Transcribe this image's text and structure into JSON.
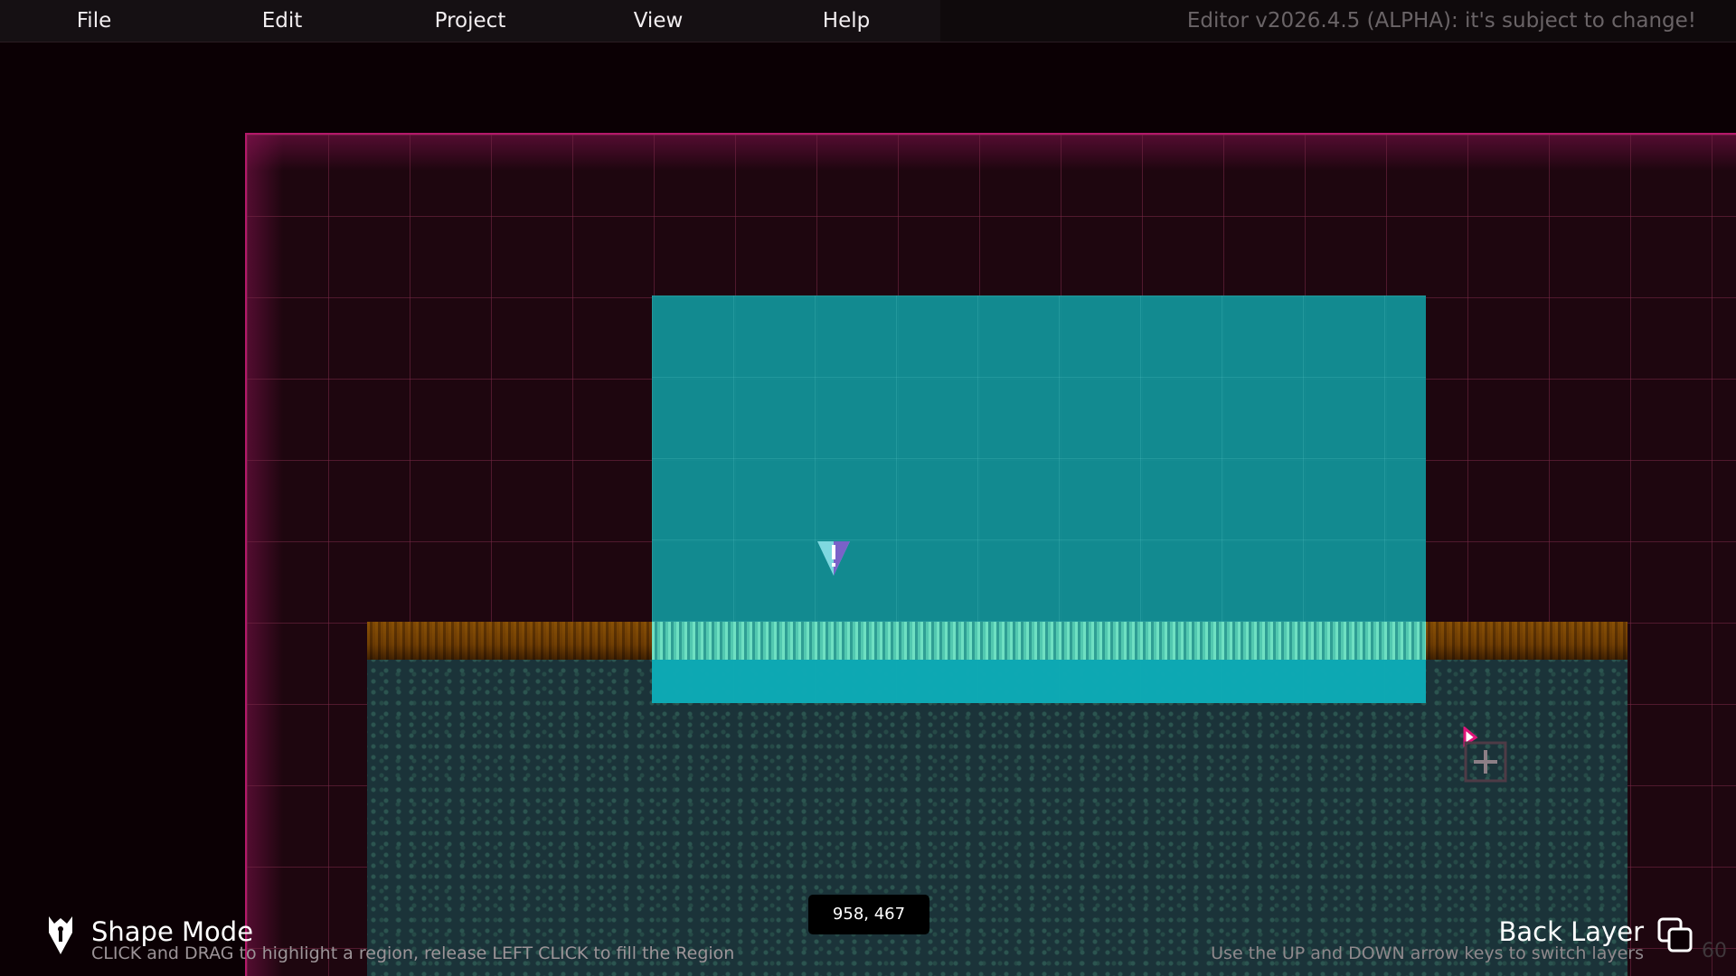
{
  "menu": {
    "items": [
      {
        "label": "File"
      },
      {
        "label": "Edit"
      },
      {
        "label": "Project"
      },
      {
        "label": "View"
      },
      {
        "label": "Help"
      }
    ],
    "version_text": "Editor v2026.4.5 (ALPHA): it's subject to change!"
  },
  "canvas": {
    "cursor_coords": "958, 467",
    "icons": {
      "spawn": "spawn-marker-icon",
      "cursor": "crosshair-cursor-icon"
    }
  },
  "status_left": {
    "mode_title": "Shape Mode",
    "mode_hint": "CLICK and DRAG to highlight a region, release LEFT CLICK to fill the Region",
    "icon": "pen-nib-icon"
  },
  "status_right": {
    "layer_title": "Back Layer",
    "layer_hint": "Use the UP and DOWN arrow keys to switch layers",
    "icon": "layers-icon",
    "fps": "60"
  },
  "colors": {
    "border_accent": "#b4186a",
    "water": "#11969b",
    "grass": "#b8963a",
    "ground": "#1b3339"
  }
}
